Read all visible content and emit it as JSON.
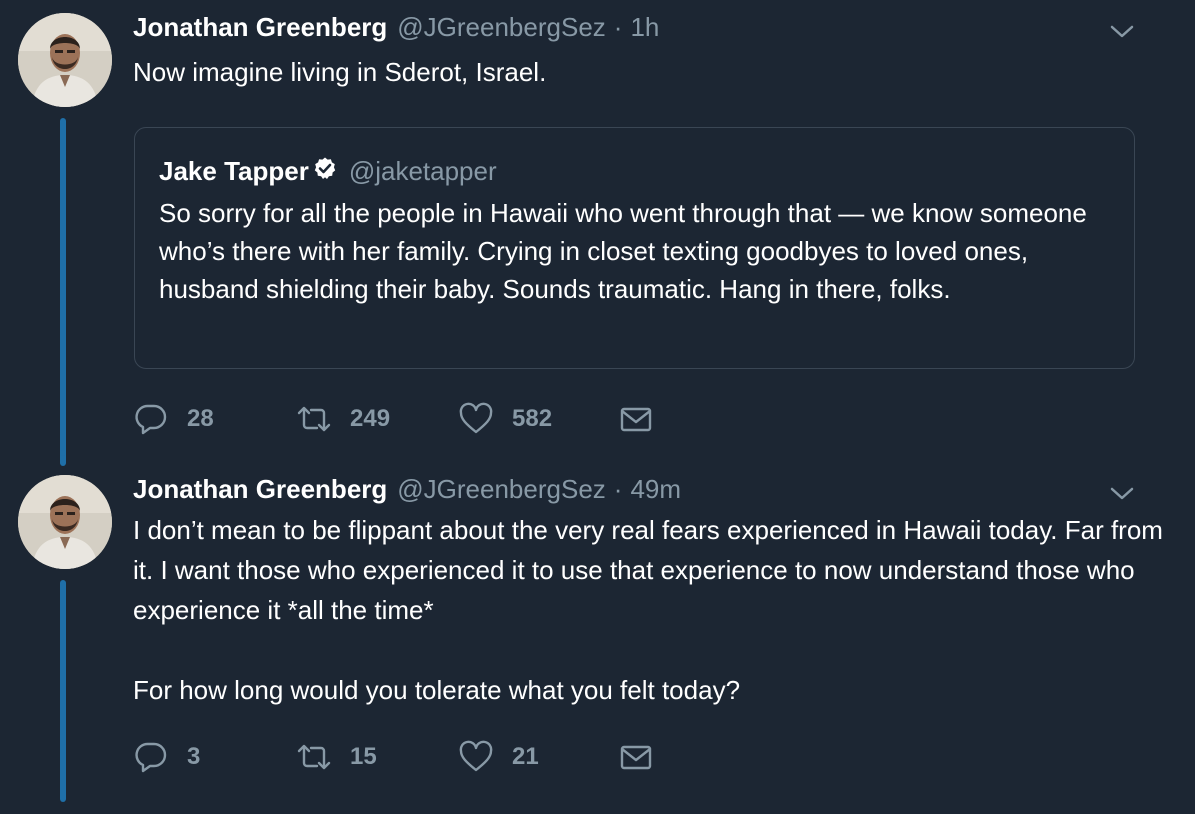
{
  "tweets": [
    {
      "author_name": "Jonathan Greenberg",
      "handle": "@JGreenbergSez",
      "separator": "·",
      "time": "1h",
      "text": "Now imagine living in Sderot, Israel.",
      "quoted": {
        "author_name": "Jake Tapper",
        "verified_icon": "verified-badge-icon",
        "handle": "@jaketapper",
        "text": "So sorry for all the people in Hawaii who went through that — we know someone who’s there with her family. Crying in closet texting goodbyes to loved ones, husband shielding their baby. Sounds traumatic. Hang in there, folks."
      },
      "replies": "28",
      "retweets": "249",
      "likes": "582"
    },
    {
      "author_name": "Jonathan Greenberg",
      "handle": "@JGreenbergSez",
      "separator": "·",
      "time": "49m",
      "text": "I don’t mean to be flippant about the very real fears experienced in Hawaii today. Far from it. I want those who experienced it to use that experience to now understand those who experience it *all the time*\n\nFor how long would you tolerate what you felt today?",
      "replies": "3",
      "retweets": "15",
      "likes": "21"
    }
  ],
  "icons": {
    "reply": "reply-icon",
    "retweet": "retweet-icon",
    "like": "heart-icon",
    "dm": "envelope-icon",
    "caret": "chevron-down-icon"
  },
  "colors": {
    "background": "#1c2633",
    "thread_line": "#1f6fa8",
    "muted": "#8899a6",
    "text": "#ffffff",
    "quote_border": "#3a4654"
  }
}
